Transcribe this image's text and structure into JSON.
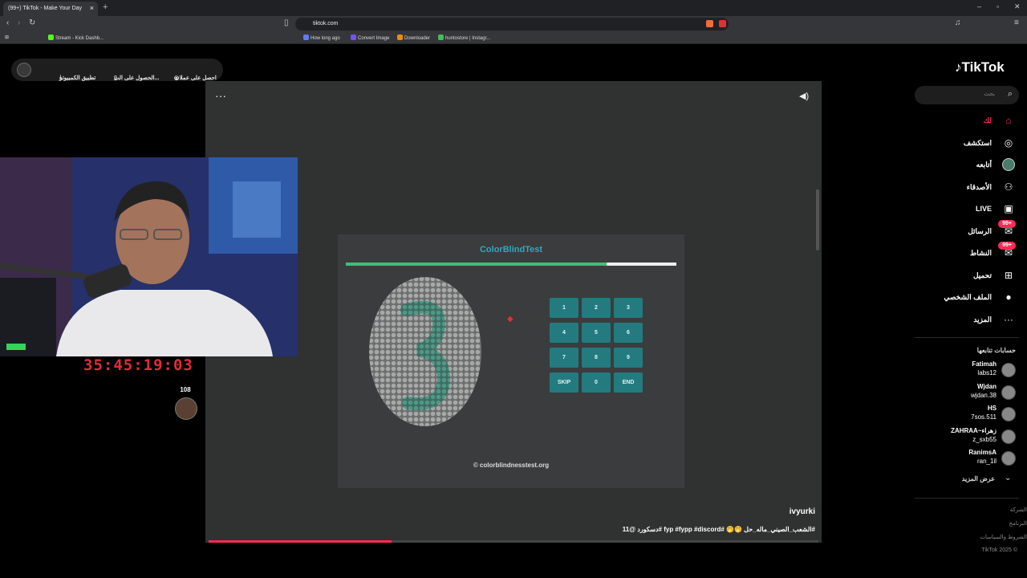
{
  "browser": {
    "tab_title": "(99+) TikTok - Make Your Day",
    "url": "tiktok.com",
    "bookmarks": [
      {
        "label": "Stream - Kick Dashb...",
        "color": "#53fc18"
      },
      {
        "label": "How long ago",
        "color": "#5c7cfa"
      },
      {
        "label": "Convert Image",
        "color": "#7950f2"
      },
      {
        "label": "Downloader",
        "color": "#f08c00"
      },
      {
        "label": "huntostore | Instagr...",
        "color": "#40c057"
      }
    ]
  },
  "top_bar": {
    "coins": "احصل على عملات",
    "get_app": "الحصول على الت...",
    "desktop_app": "تطبيق الكمبيوتر"
  },
  "video": {
    "game_title": "ColorBlindTest",
    "progress": 0.79,
    "keypad": [
      "1",
      "2",
      "3",
      "4",
      "5",
      "6",
      "7",
      "8",
      "9",
      "SKIP",
      "0",
      "END"
    ],
    "footer": "© colorblindnesstest.org",
    "author": "ivyurki",
    "caption": "#الشعب_الصيني_ماله_حل 🤭🤭 #fyp #fypp #discord #دسكورد @11",
    "playback_progress": 0.3,
    "colors": {
      "accent": "#35a7bf",
      "key_bg": "#237b7f",
      "progress_green": "#3cbf7a",
      "tiktok_red": "#fe2c55"
    }
  },
  "overlay": {
    "timer": "35:45:19:03",
    "viewer_count": "108"
  },
  "sidebar": {
    "logo": "TikTok",
    "search_placeholder": "بحث",
    "nav": [
      {
        "label": "لك",
        "icon": "home-icon"
      },
      {
        "label": "استكشف",
        "icon": "compass-icon"
      },
      {
        "label": "أتابعه",
        "icon": "avatar-icon"
      },
      {
        "label": "الأصدقاء",
        "icon": "friends-icon"
      },
      {
        "label": "LIVE",
        "icon": "live-icon"
      },
      {
        "label": "الرسائل",
        "icon": "messages-icon",
        "badge": "99+"
      },
      {
        "label": "النشاط",
        "icon": "activity-icon",
        "badge": "99+"
      },
      {
        "label": "تحميل",
        "icon": "upload-icon"
      },
      {
        "label": "الملف الشخصي",
        "icon": "profile-icon"
      },
      {
        "label": "المزيد",
        "icon": "more-icon"
      }
    ],
    "following_title": "حسابات تتابعها",
    "following": [
      {
        "name": "Fatimah",
        "handle": "labs12"
      },
      {
        "name": "Wjdan",
        "handle": "wjdan.38"
      },
      {
        "name": "HS",
        "handle": "7sos.511"
      },
      {
        "name": "ZAHRAA~زهراء",
        "handle": "z_sxb55"
      },
      {
        "name": "RanimsA",
        "handle": "ran_1il"
      }
    ],
    "see_more": "عرض المزيد",
    "footer": [
      "الشركة",
      "البرنامج",
      "الشروط والسياسات",
      "TikTok 2025 ©"
    ]
  }
}
